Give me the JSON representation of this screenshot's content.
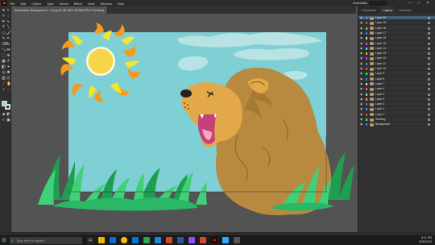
{
  "app": {
    "logo": "Ai",
    "name": "Adobe Illustrator"
  },
  "menu": [
    "File",
    "Edit",
    "Object",
    "Type",
    "Select",
    "Effect",
    "View",
    "Window",
    "Help"
  ],
  "workspace_label": "Essentials",
  "window_controls": [
    "—",
    "□",
    "✕"
  ],
  "document_tab": "Illustration Background - Copy.ai* @ 58% (RGB/GPU Preview)",
  "panel_tabs": [
    "Properties",
    "Layers",
    "Libraries"
  ],
  "layers": [
    "Layer 20",
    "Layer 19",
    "Layer 18",
    "Layer 17",
    "Layer 16",
    "Layer 15",
    "Layer 14",
    "Layer 13",
    "Layer 12",
    "Layer 11",
    "Layer 10",
    "Layer 9",
    "Layer 8",
    "Layer 7",
    "Layer 6",
    "Layer 5",
    "Layer 4",
    "Layer 3",
    "Layer 2",
    "Layer 1",
    "Shading",
    "Background"
  ],
  "layer_colors": [
    "#4f8fe8",
    "#e84f4f",
    "#4fe86b",
    "#3f7bff",
    "#ffde4f",
    "#e84fe8",
    "#4fe8e8",
    "#ff9f4f",
    "#9f4fff",
    "#4f8fe8",
    "#e84f4f",
    "#4fe86b",
    "#3f7bff",
    "#ffde4f",
    "#e84fe8",
    "#4fe8e8",
    "#ff9f4f",
    "#9f4fff",
    "#4f8fe8",
    "#e84f4f",
    "#4fe86b",
    "#3f7bff"
  ],
  "selected_layer": "Layer 20",
  "taskbar": {
    "search_placeholder": "Type here to search",
    "time": "8:11 PM",
    "date": "8/15/2022"
  },
  "icons": {
    "start": "windows-logo-icon",
    "search": "search-icon",
    "eye": "eye-icon"
  },
  "colors": {
    "sky": "#7fd0d4",
    "sun": "#f7d54a",
    "sun_rays_yellow": "#f5e62c",
    "sun_rays_orange": "#f59a1a",
    "mane": "#b88a40",
    "face": "#e3a847",
    "grass_dark": "#1e9e50",
    "grass_light": "#3fd078"
  }
}
